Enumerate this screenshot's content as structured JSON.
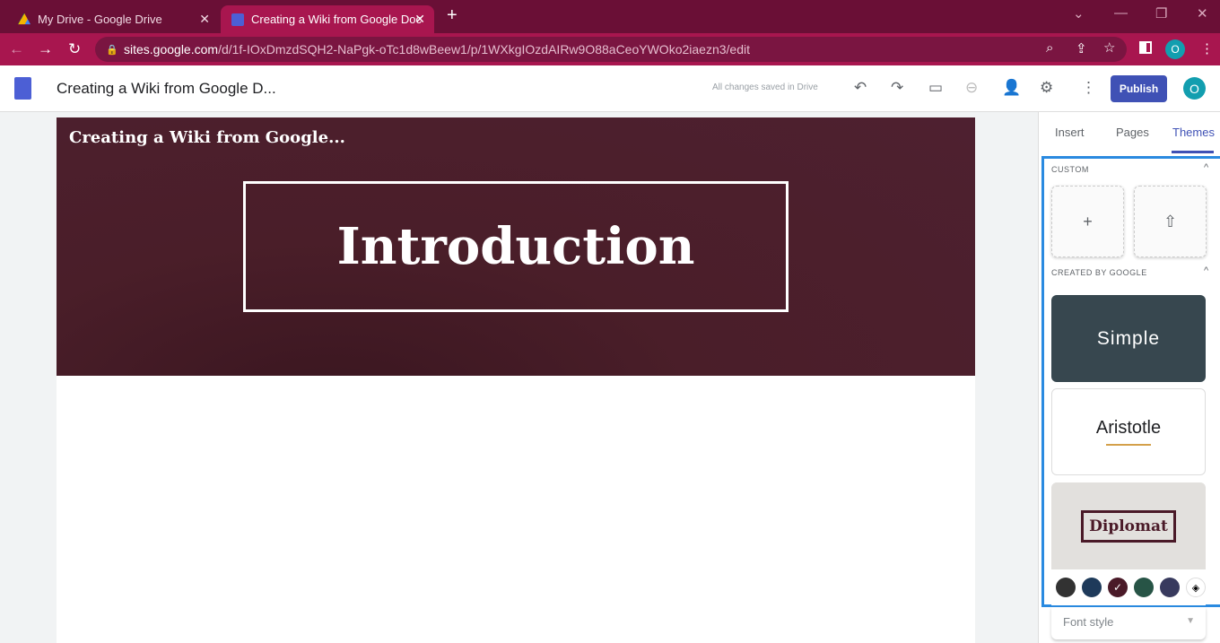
{
  "browser": {
    "tabs": [
      {
        "label": "My Drive - Google Drive",
        "icon": "google-drive-icon"
      },
      {
        "label": "Creating a Wiki from Google Doc",
        "icon": "google-sites-icon",
        "active": true
      }
    ],
    "url_host": "sites.google.com",
    "url_path": "/d/1f-IOxDmzdSQH2-NaPgk-oTc1d8wBeew1/p/1WXkgIOzdAIRw9O88aCeoYWOko2iaezn3/edit",
    "profile_initial": "O",
    "accent": "#a8164f"
  },
  "app": {
    "title": "Creating a Wiki from Google D...",
    "save_status": "All changes saved in Drive",
    "publish_label": "Publish",
    "user_initial": "O",
    "publish_color": "#3f51b5"
  },
  "page": {
    "site_name": "Creating a Wiki from Google...",
    "header_title": "Introduction"
  },
  "panel": {
    "tabs": [
      "Insert",
      "Pages",
      "Themes"
    ],
    "active_tab": "Themes",
    "custom_label": "CUSTOM",
    "google_label": "CREATED BY GOOGLE",
    "themes": [
      {
        "name": "Simple"
      },
      {
        "name": "Aristotle"
      },
      {
        "name": "Diplomat",
        "selected": true
      }
    ],
    "swatches": [
      "#323232",
      "#1e3a5a",
      "#4a1a28",
      "#275446",
      "#383a5e"
    ],
    "selected_swatch": 2,
    "font_style_label": "Font style"
  }
}
